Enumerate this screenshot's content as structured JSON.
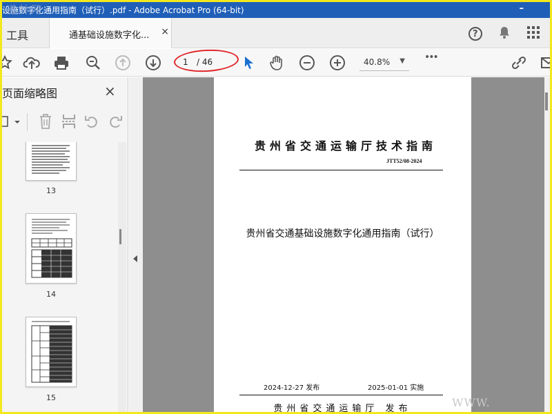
{
  "window": {
    "title": "设施数字化通用指南（试行）.pdf - Adobe Acrobat Pro (64-bit)",
    "watermark": "道林网",
    "minimize_glyph": "–"
  },
  "tabs": {
    "tools_label": "工具",
    "document_tab_label": "通基础设施数字化...",
    "close_glyph": "×"
  },
  "toolbar": {
    "current_page": "1",
    "total_pages": "/ 46",
    "zoom": "40.8%",
    "zoom_caret": "▼",
    "more_glyph": "•••"
  },
  "sidebar": {
    "title": "页面缩略图",
    "close_glyph": "×",
    "thumbnails": [
      {
        "page": "13"
      },
      {
        "page": "14"
      },
      {
        "page": "15"
      }
    ]
  },
  "document": {
    "standard_name": "贵州省交通运输厅技术指南",
    "standard_code": "JTT52/08-2024",
    "main_title": "贵州省交通基础设施数字化通用指南（试行）",
    "publish_date": "2024-12-27  发布",
    "implement_date": "2025-01-01  实施",
    "issuer": "贵州省交通运输厅  发布",
    "watermark_url": "WWW."
  },
  "colors": {
    "title_bar": "#1f5fb8",
    "annotation_oval": "#e0262a",
    "outer_border": "#f2e81c",
    "cursor_blue": "#1a6fd1"
  }
}
